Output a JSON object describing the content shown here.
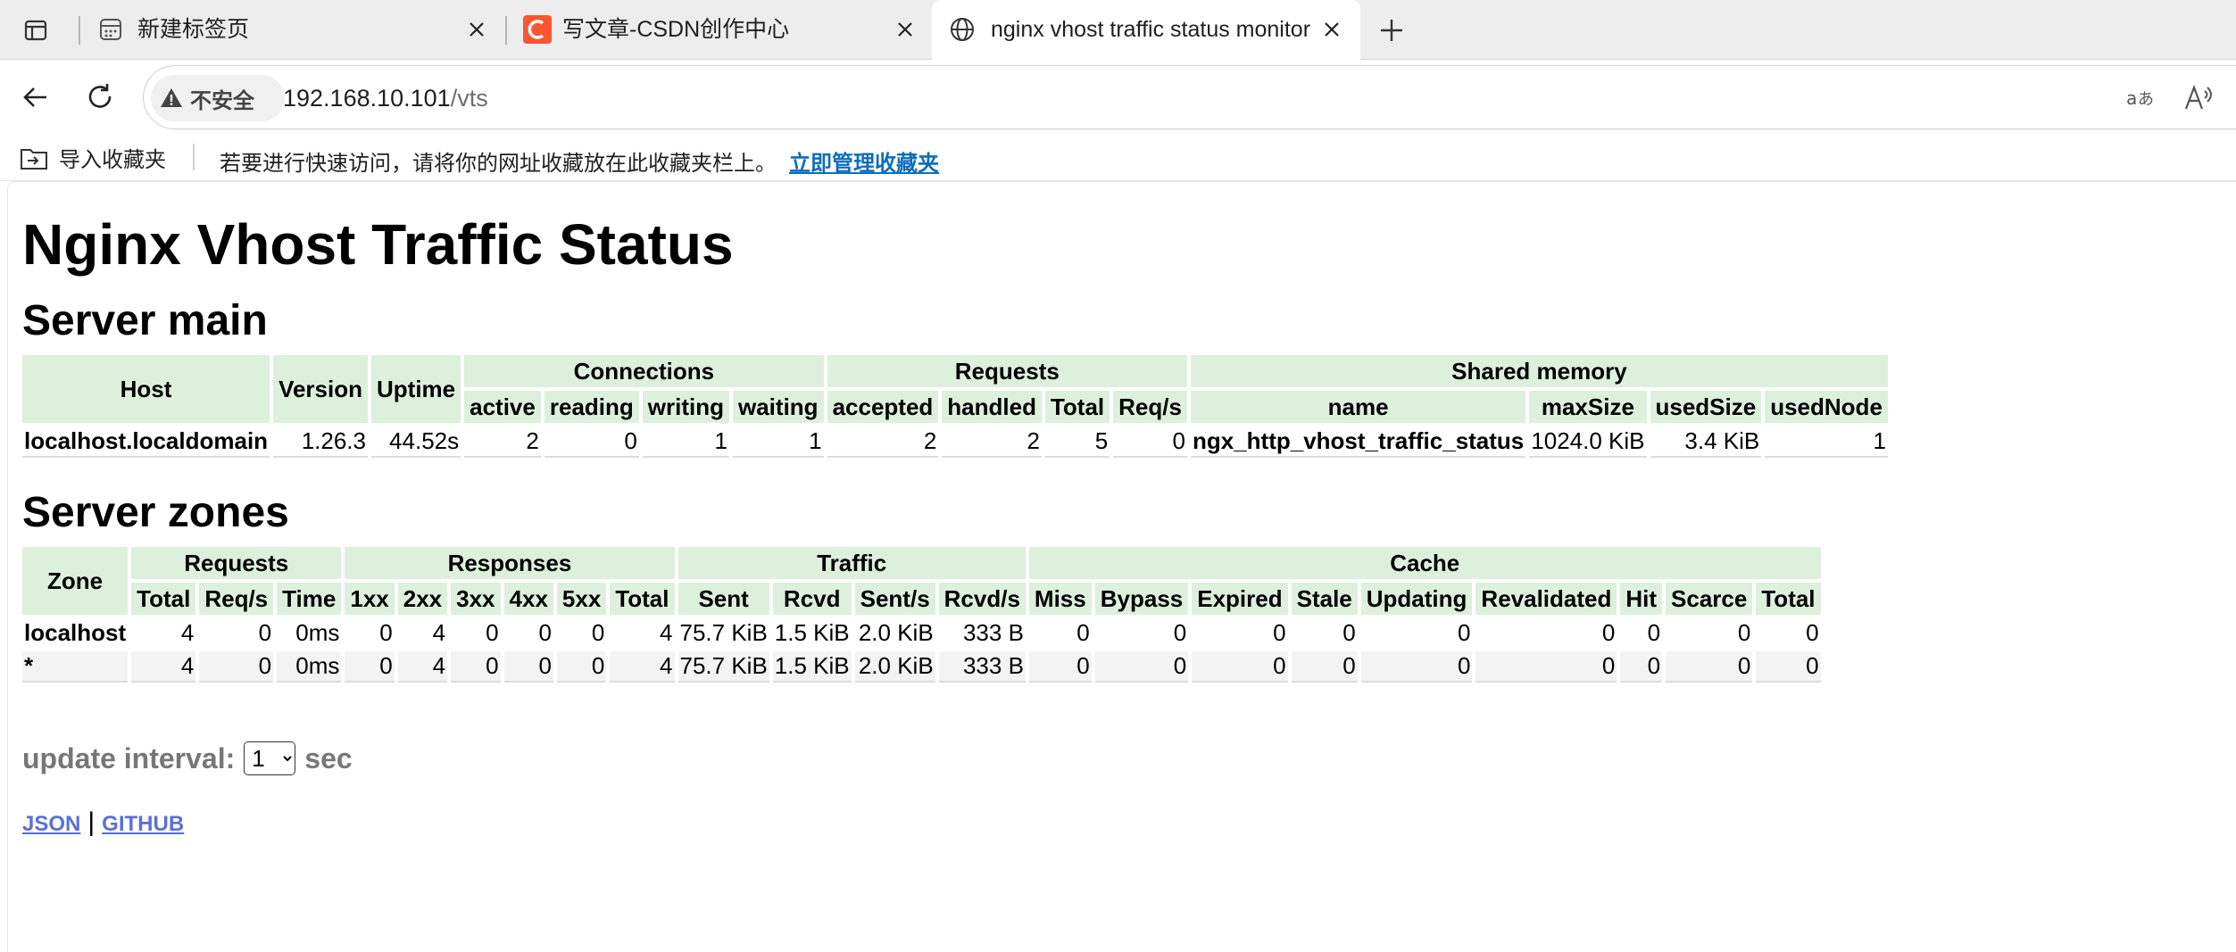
{
  "browser": {
    "tabs": [
      {
        "title": "新建标签页",
        "active": false
      },
      {
        "title": "写文章-CSDN创作中心",
        "active": false
      },
      {
        "title": "nginx vhost traffic status monitor",
        "active": true
      }
    ],
    "address": {
      "security_label": "不安全",
      "host": "192.168.10.101",
      "path": "/vts"
    },
    "favorites_bar": {
      "import_label": "导入收藏夹",
      "hint": "若要进行快速访问，请将你的网址收藏放在此收藏夹栏上。",
      "manage_link": "立即管理收藏夹"
    },
    "colors": {
      "csdn_brand": "#fc5531",
      "link_blue": "#0f6cbd"
    }
  },
  "page": {
    "title": "Nginx Vhost Traffic Status",
    "server_main": {
      "heading": "Server main",
      "headers": {
        "host": "Host",
        "version": "Version",
        "uptime": "Uptime",
        "connections": "Connections",
        "requests": "Requests",
        "shared_memory": "Shared memory",
        "active": "active",
        "reading": "reading",
        "writing": "writing",
        "waiting": "waiting",
        "accepted": "accepted",
        "handled": "handled",
        "total": "Total",
        "req_s": "Req/s",
        "name": "name",
        "max_size": "maxSize",
        "used_size": "usedSize",
        "used_node": "usedNode"
      },
      "row": {
        "host": "localhost.localdomain",
        "version": "1.26.3",
        "uptime": "44.52s",
        "active": "2",
        "reading": "0",
        "writing": "1",
        "waiting": "1",
        "accepted": "2",
        "handled": "2",
        "total": "5",
        "req_s": "0",
        "name": "ngx_http_vhost_traffic_status",
        "max_size": "1024.0 KiB",
        "used_size": "3.4 KiB",
        "used_node": "1"
      }
    },
    "server_zones": {
      "heading": "Server zones",
      "headers": {
        "zone": "Zone",
        "requests": "Requests",
        "responses": "Responses",
        "traffic": "Traffic",
        "cache": "Cache",
        "total": "Total",
        "req_s": "Req/s",
        "time": "Time",
        "r1xx": "1xx",
        "r2xx": "2xx",
        "r3xx": "3xx",
        "r4xx": "4xx",
        "r5xx": "5xx",
        "resp_total": "Total",
        "sent": "Sent",
        "rcvd": "Rcvd",
        "sent_s": "Sent/s",
        "rcvd_s": "Rcvd/s",
        "miss": "Miss",
        "bypass": "Bypass",
        "expired": "Expired",
        "stale": "Stale",
        "updating": "Updating",
        "revalidated": "Revalidated",
        "hit": "Hit",
        "scarce": "Scarce",
        "cache_total": "Total"
      },
      "rows": [
        {
          "zone": "localhost",
          "total": "4",
          "req_s": "0",
          "time": "0ms",
          "r1xx": "0",
          "r2xx": "4",
          "r3xx": "0",
          "r4xx": "0",
          "r5xx": "0",
          "resp_total": "4",
          "sent": "75.7 KiB",
          "rcvd": "1.5 KiB",
          "sent_s": "2.0 KiB",
          "rcvd_s": "333 B",
          "miss": "0",
          "bypass": "0",
          "expired": "0",
          "stale": "0",
          "updating": "0",
          "revalidated": "0",
          "hit": "0",
          "scarce": "0",
          "cache_total": "0"
        },
        {
          "zone": "*",
          "total": "4",
          "req_s": "0",
          "time": "0ms",
          "r1xx": "0",
          "r2xx": "4",
          "r3xx": "0",
          "r4xx": "0",
          "r5xx": "0",
          "resp_total": "4",
          "sent": "75.7 KiB",
          "rcvd": "1.5 KiB",
          "sent_s": "2.0 KiB",
          "rcvd_s": "333 B",
          "miss": "0",
          "bypass": "0",
          "expired": "0",
          "stale": "0",
          "updating": "0",
          "revalidated": "0",
          "hit": "0",
          "scarce": "0",
          "cache_total": "0"
        }
      ]
    },
    "update_interval": {
      "label": "update interval:",
      "value": "1",
      "unit": "sec"
    },
    "links": {
      "json": "JSON",
      "separator": "|",
      "github": "GITHUB"
    },
    "colors": {
      "header_bg": "#dcf0dc",
      "row_alt_bg": "#f3f3f3",
      "footer_link": "#5a6fd8"
    }
  }
}
